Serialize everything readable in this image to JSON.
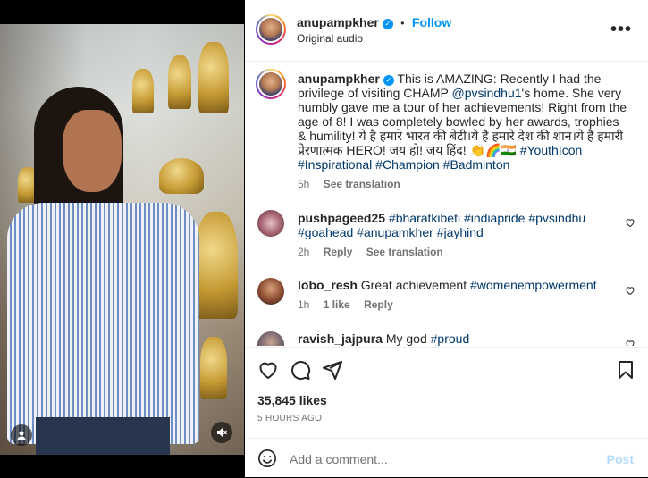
{
  "post": {
    "username": "anupampkher",
    "follow_label": "Follow",
    "separator": "•",
    "audio": "Original audio",
    "more_label": "•••",
    "caption_parts": [
      {
        "text": "This is AMAZING: Recently I had the privilege of visiting CHAMP ",
        "tag": false
      },
      {
        "text": "@pvsindhu1",
        "tag": true
      },
      {
        "text": "'s home. She very humbly gave me a tour of her achievements! Right from the age of 8! I was completely bowled by her awards, trophies & humility! ये है हमारे भारत की बेटी।ये है हमारे देश की शान।ये है हमारी प्रेरणात्मक HERO! जय हो! जय हिंद! 👏🌈🇮🇳 ",
        "tag": false
      },
      {
        "text": "#YouthIcon",
        "tag": true
      },
      {
        "text": " ",
        "tag": false
      },
      {
        "text": "#Inspirational",
        "tag": true
      },
      {
        "text": " ",
        "tag": false
      },
      {
        "text": "#Champion",
        "tag": true
      },
      {
        "text": " ",
        "tag": false
      },
      {
        "text": "#Badminton",
        "tag": true
      }
    ],
    "caption_time": "5h",
    "see_translation": "See translation",
    "likes": "35,845 likes",
    "time_ago": "5 HOURS AGO",
    "add_comment_placeholder": "Add a comment...",
    "post_label": "Post"
  },
  "comments": [
    {
      "username": "pushpageed25",
      "text": "#bharatkibeti #indiapride #pvsindhu #goahead #anupamkher #jayhind",
      "time": "2h",
      "reply": "Reply",
      "see_translation": "See translation"
    },
    {
      "username": "lobo_resh",
      "text_plain": "Great achievement ",
      "text_tag": "#womenempowerment",
      "time": "1h",
      "likes": "1 like",
      "reply": "Reply"
    },
    {
      "username": "ravish_jajpura",
      "text_plain": "My god ",
      "text_tag": "#proud"
    }
  ],
  "colors": {
    "link": "#0095f6",
    "hashtag": "#00376b",
    "muted": "#737373"
  }
}
